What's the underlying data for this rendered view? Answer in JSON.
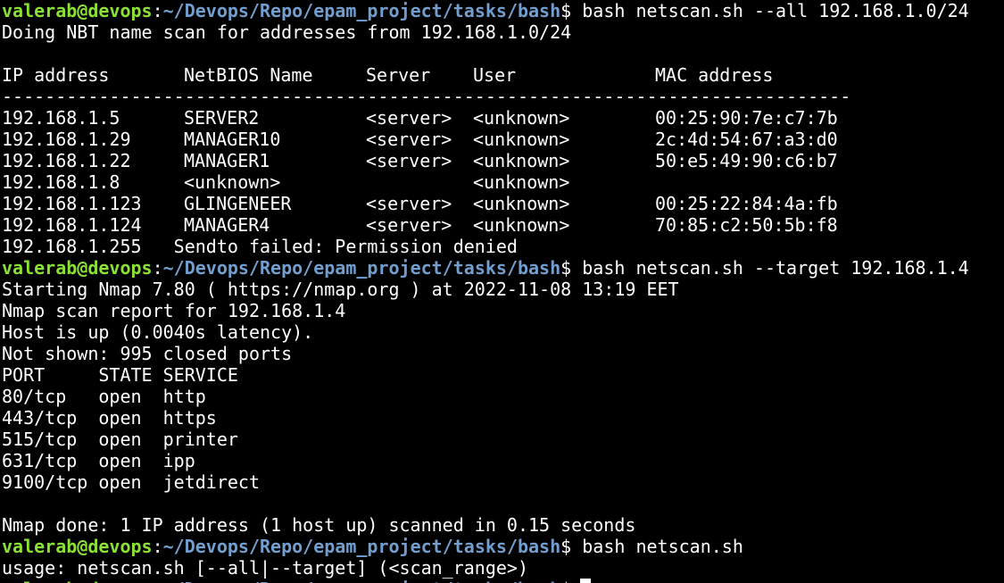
{
  "colors": {
    "background": "#000000",
    "text": "#ffffff",
    "prompt_user": "#8ae234",
    "prompt_path": "#729fcf"
  },
  "prompt": {
    "user_host": "valerab@devops",
    "colon": ":",
    "path": "~/Devops/Repo/epam_project/tasks/bash",
    "dollar": "$"
  },
  "commands": {
    "c1": " bash netscan.sh --all 192.168.1.0/24",
    "c2": " bash netscan.sh --target 192.168.1.4",
    "c3": " bash netscan.sh"
  },
  "nbt": {
    "intro": "Doing NBT name scan for addresses from 192.168.1.0/24",
    "headers": {
      "ip": "IP address",
      "netbios": "NetBIOS Name",
      "server": "Server",
      "user": "User",
      "mac": "MAC address"
    },
    "separator": "-------------------------------------------------------------------------------",
    "rows": [
      {
        "ip": "192.168.1.5",
        "netbios": "SERVER2",
        "server": "<server>",
        "user": "<unknown>",
        "mac": "00:25:90:7e:c7:7b"
      },
      {
        "ip": "192.168.1.29",
        "netbios": "MANAGER10",
        "server": "<server>",
        "user": "<unknown>",
        "mac": "2c:4d:54:67:a3:d0"
      },
      {
        "ip": "192.168.1.22",
        "netbios": "MANAGER1",
        "server": "<server>",
        "user": "<unknown>",
        "mac": "50:e5:49:90:c6:b7"
      },
      {
        "ip": "192.168.1.8",
        "netbios": "<unknown>",
        "server": "",
        "user": "<unknown>",
        "mac": ""
      },
      {
        "ip": "192.168.1.123",
        "netbios": "GLINGENEER",
        "server": "<server>",
        "user": "<unknown>",
        "mac": "00:25:22:84:4a:fb"
      },
      {
        "ip": "192.168.1.124",
        "netbios": "MANAGER4",
        "server": "<server>",
        "user": "<unknown>",
        "mac": "70:85:c2:50:5b:f8"
      }
    ],
    "error": "192.168.1.255   Sendto failed: Permission denied"
  },
  "nmap": {
    "start": "Starting Nmap 7.80 ( https://nmap.org ) at 2022-11-08 13:19 EET",
    "report": "Nmap scan report for 192.168.1.4",
    "host_up": "Host is up (0.0040s latency).",
    "not_shown": "Not shown: 995 closed ports",
    "port_header": "PORT     STATE SERVICE",
    "ports": [
      "80/tcp   open  http",
      "443/tcp  open  https",
      "515/tcp  open  printer",
      "631/tcp  open  ipp",
      "9100/tcp open  jetdirect"
    ],
    "done": "Nmap done: 1 IP address (1 host up) scanned in 0.15 seconds"
  },
  "usage": "usage: netscan.sh [--all|--target] (<scan_range>)"
}
